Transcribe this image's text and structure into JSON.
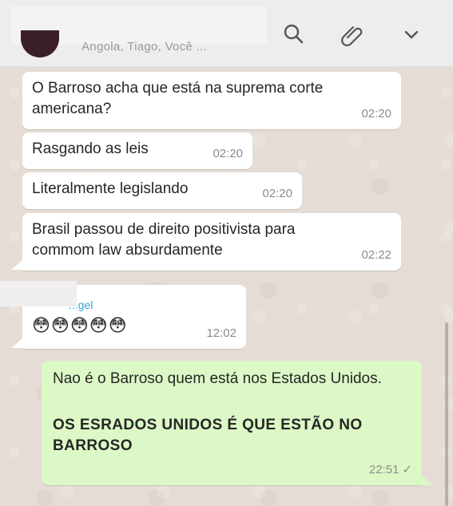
{
  "header": {
    "subtitle": "Angola, Tiago, Você ...",
    "icons": [
      "search-icon",
      "paperclip-icon",
      "chevron-down-icon"
    ]
  },
  "messages": [
    {
      "text": "O Barroso acha que está na suprema corte\namericana?",
      "time": "02:20"
    },
    {
      "text": "Rasgando as leis",
      "time": "02:20"
    },
    {
      "text": "Literalmente legislando",
      "time": "02:20"
    },
    {
      "text": "Brasil passou de direito positivista para\ncommom law absurdamente",
      "time": "02:22"
    },
    {
      "sender": "...gel",
      "text": "😳😳😳😳😳",
      "time": "12:02"
    }
  ],
  "outgoing": {
    "line1": "Nao é o Barroso quem está nos Estados Unidos.",
    "line2": "OS ESRADOS UNIDOS É QUE ESTÃO NO\nBARROSO",
    "time": "22:51",
    "status": "✓"
  },
  "colors": {
    "incoming_bg": "#ffffff",
    "outgoing_bg": "#dcf8c6",
    "chat_bg": "#e5ddd5",
    "sender_name": "#35a5d8"
  }
}
